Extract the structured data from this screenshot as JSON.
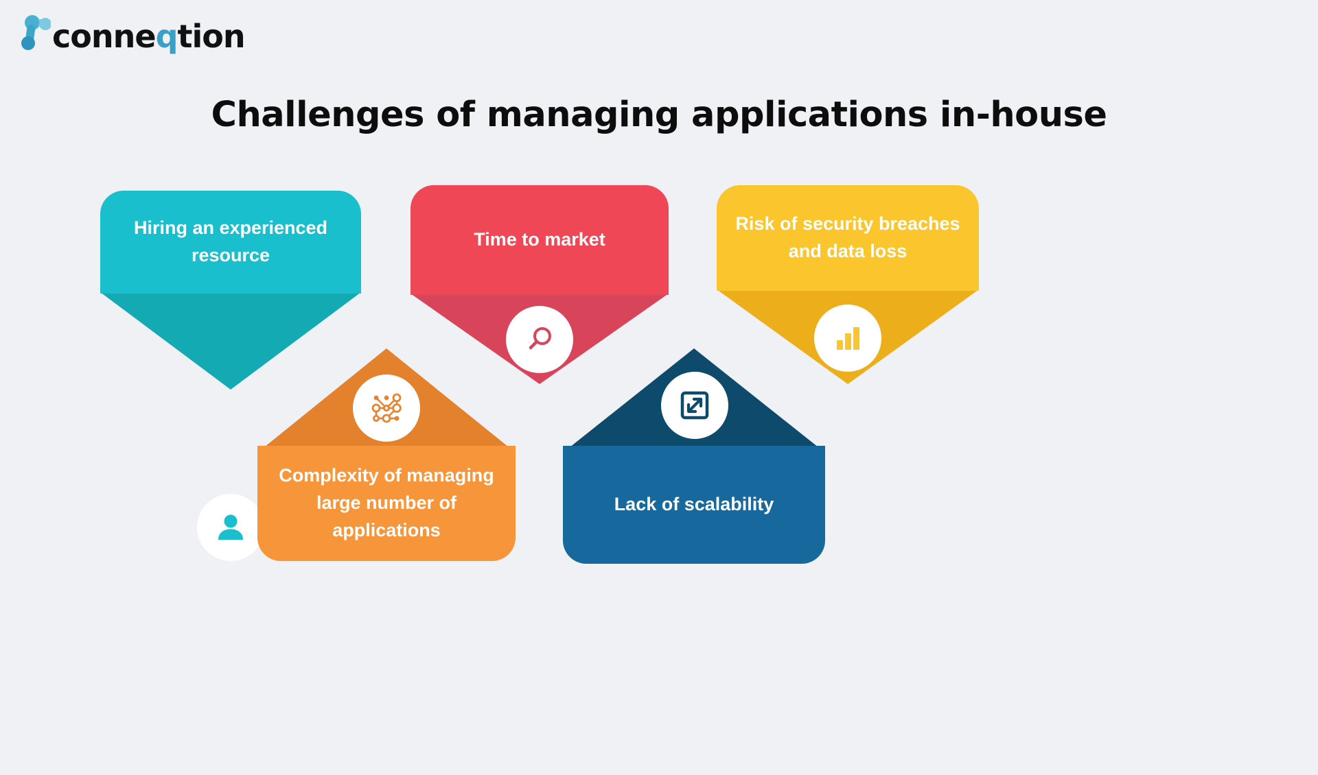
{
  "brand": {
    "name": "conneqtion",
    "name_part1": "conne",
    "name_accent": "q",
    "name_part2": "tion",
    "mark_icon": "network-node-icon",
    "accent_color": "#3aa0c8",
    "mark_color_light": "#6cc4dd",
    "mark_color_dark": "#2e93be"
  },
  "page": {
    "title": "Challenges of managing applications in-house",
    "background_color": "#eff1f5",
    "title_color": "#0d0d0d"
  },
  "cards": [
    {
      "id": "hiring-an-experienced-resource",
      "label": "Hiring an experienced resource",
      "direction": "down",
      "color": "#19bfcc",
      "shade_color": "#14aab4",
      "icon": "person-icon",
      "icon_color": "#19bfcc"
    },
    {
      "id": "time-to-market",
      "label": "Time to market",
      "direction": "down",
      "color": "#f04757",
      "shade_color": "#d8445a",
      "icon": "search-icon",
      "icon_color": "#d8445a"
    },
    {
      "id": "risk-of-security-breaches-and-data-loss",
      "label": "Risk of security breaches and data loss",
      "direction": "down",
      "color": "#fbc52e",
      "shade_color": "#edae1c",
      "icon": "bar-chart-icon",
      "icon_color": "#fbc52e"
    },
    {
      "id": "complexity-of-managing-large-number-of-applications",
      "label": "Complexity of managing large number of applications",
      "direction": "up",
      "color": "#f7953a",
      "shade_color": "#e4812c",
      "icon": "network-nodes-icon",
      "icon_color": "#e8822f"
    },
    {
      "id": "lack-of-scalability",
      "label": "Lack of scalability",
      "direction": "up",
      "color": "#17689c",
      "shade_color": "#0e4a6b",
      "icon": "expand-arrow-icon",
      "icon_color": "#0e4a6b"
    }
  ]
}
